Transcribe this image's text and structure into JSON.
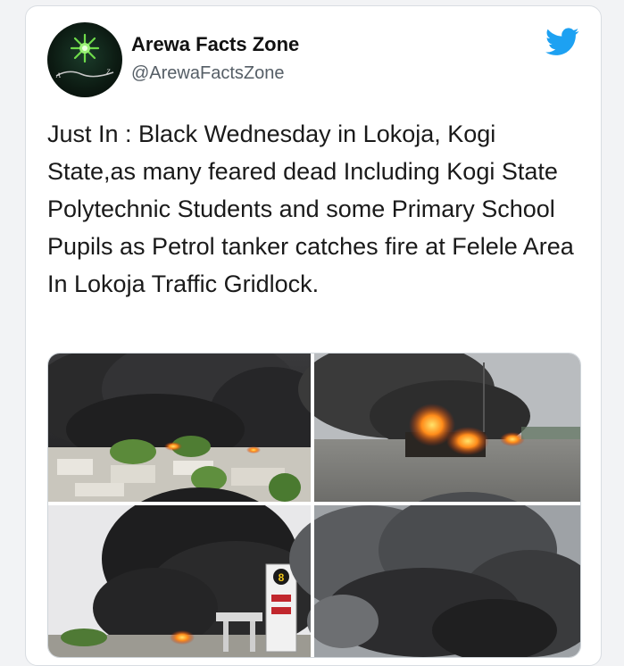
{
  "tweet": {
    "display_name": "Arewa Facts Zone",
    "handle": "@ArewaFactsZone",
    "avatar_logo_text": "Arewa Facts Zone",
    "text": "Just In : Black Wednesday in Lokoja, Kogi State,as many feared dead Including Kogi State Polytechnic Students and some Primary School Pupils as Petrol tanker catches fire at Felele Area In Lokoja Traffic Gridlock.",
    "brand_icon": "twitter-bird-icon",
    "brand_color": "#1da1f2"
  },
  "media": {
    "images": [
      {
        "name": "smoke-over-town-photo"
      },
      {
        "name": "burning-tanker-photo"
      },
      {
        "name": "smoke-filling-station-photo",
        "sign_text": "8"
      },
      {
        "name": "dense-smoke-photo"
      }
    ]
  }
}
